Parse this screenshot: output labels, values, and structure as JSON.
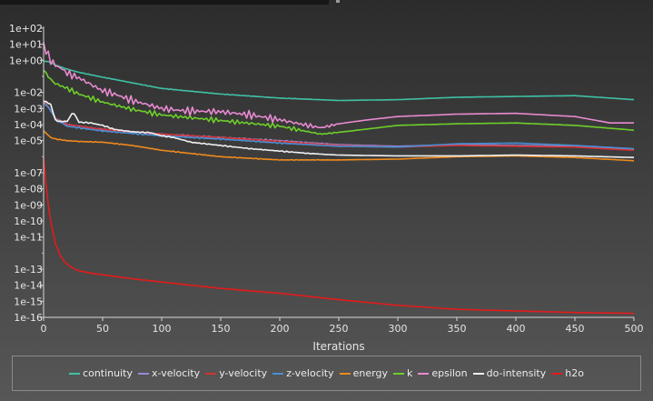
{
  "chart_data": {
    "type": "line",
    "title": "",
    "xlabel": "Iterations",
    "ylabel": "",
    "xlim": [
      0,
      500
    ],
    "x_ticks": [
      0,
      50,
      100,
      150,
      200,
      250,
      300,
      350,
      400,
      450,
      500
    ],
    "y_scale": "log",
    "ylim_exp": [
      -16,
      2
    ],
    "y_tick_labels": [
      "1e+02",
      "1e+01",
      "1e+00",
      "1e-02",
      "1e-03",
      "1e-04",
      "1e-05",
      "1e-07",
      "1e-08",
      "1e-09",
      "1e-10",
      "1e-11",
      "1e-13",
      "1e-14",
      "1e-15",
      "1e-16"
    ],
    "y_tick_exps": [
      2,
      1,
      0,
      -2,
      -3,
      -4,
      -5,
      -7,
      -8,
      -9,
      -10,
      -11,
      -13,
      -14,
      -15,
      -16
    ],
    "grid": false,
    "legend_position": "bottom",
    "series": [
      {
        "name": "continuity",
        "color": "#3fc1a6",
        "x": [
          0,
          5,
          10,
          20,
          30,
          50,
          75,
          100,
          150,
          200,
          250,
          300,
          350,
          400,
          450,
          500
        ],
        "log10y": [
          -0.05,
          -0.1,
          -0.3,
          -0.55,
          -0.75,
          -1.05,
          -1.4,
          -1.75,
          -2.1,
          -2.35,
          -2.5,
          -2.45,
          -2.3,
          -2.25,
          -2.2,
          -2.45
        ]
      },
      {
        "name": "x-velocity",
        "color": "#9a8ad8",
        "x": [
          0,
          5,
          10,
          20,
          30,
          50,
          75,
          100,
          150,
          200,
          250,
          300,
          350,
          400,
          450,
          500
        ],
        "log10y": [
          -2.6,
          -3.0,
          -3.6,
          -4.0,
          -4.1,
          -4.3,
          -4.45,
          -4.6,
          -4.8,
          -5.0,
          -5.25,
          -5.35,
          -5.25,
          -5.3,
          -5.35,
          -5.55
        ]
      },
      {
        "name": "y-velocity",
        "color": "#d63030",
        "x": [
          0,
          5,
          10,
          20,
          30,
          50,
          75,
          100,
          150,
          200,
          250,
          300,
          350,
          400,
          450,
          500
        ],
        "log10y": [
          -2.5,
          -3.0,
          -3.6,
          -4.0,
          -4.1,
          -4.3,
          -4.45,
          -4.6,
          -4.8,
          -5.05,
          -5.3,
          -5.4,
          -5.3,
          -5.35,
          -5.4,
          -5.6
        ]
      },
      {
        "name": "z-velocity",
        "color": "#4a8fd4",
        "x": [
          0,
          5,
          10,
          20,
          30,
          50,
          75,
          100,
          150,
          200,
          250,
          300,
          350,
          400,
          450,
          500
        ],
        "log10y": [
          -2.6,
          -3.0,
          -3.65,
          -4.1,
          -4.2,
          -4.4,
          -4.55,
          -4.7,
          -4.9,
          -5.15,
          -5.35,
          -5.4,
          -5.2,
          -5.15,
          -5.3,
          -5.5
        ]
      },
      {
        "name": "energy",
        "color": "#ee8a1e",
        "x": [
          0,
          3,
          6,
          10,
          20,
          30,
          50,
          75,
          100,
          150,
          200,
          250,
          300,
          350,
          400,
          450,
          500
        ],
        "log10y": [
          -4.4,
          -4.6,
          -4.8,
          -4.9,
          -5.0,
          -5.05,
          -5.1,
          -5.3,
          -5.6,
          -6.0,
          -6.2,
          -6.2,
          -6.15,
          -6.0,
          -5.95,
          -6.05,
          -6.25
        ]
      },
      {
        "name": "k",
        "color": "#6ecf2a",
        "x": [
          0,
          3,
          6,
          10,
          20,
          30,
          50,
          75,
          100,
          150,
          200,
          235,
          260,
          300,
          350,
          400,
          450,
          500
        ],
        "log10y": [
          -0.6,
          -0.9,
          -1.2,
          -1.45,
          -1.75,
          -2.1,
          -2.6,
          -3.05,
          -3.4,
          -3.75,
          -4.1,
          -4.6,
          -4.4,
          -4.05,
          -3.95,
          -3.9,
          -4.05,
          -4.35
        ]
      },
      {
        "name": "epsilon",
        "color": "#e88ad0",
        "x": [
          0,
          2,
          4,
          6,
          10,
          15,
          20,
          30,
          40,
          50,
          60,
          75,
          90,
          100,
          120,
          150,
          175,
          200,
          220,
          235,
          250,
          275,
          300,
          350,
          400,
          450,
          480,
          500
        ],
        "log10y": [
          1.0,
          0.6,
          0.3,
          0.0,
          -0.3,
          -0.5,
          -0.8,
          -1.1,
          -1.5,
          -1.9,
          -2.1,
          -2.5,
          -2.8,
          -3.0,
          -3.15,
          -3.2,
          -3.4,
          -3.7,
          -4.0,
          -4.2,
          -3.95,
          -3.7,
          -3.5,
          -3.35,
          -3.3,
          -3.5,
          -3.9,
          -3.9
        ]
      },
      {
        "name": "do-intensity",
        "color": "#f0f0f0",
        "x": [
          0,
          3,
          6,
          10,
          12,
          20,
          25,
          30,
          40,
          50,
          60,
          75,
          90,
          100,
          110,
          125,
          150,
          175,
          200,
          225,
          250,
          300,
          350,
          400,
          450,
          500
        ],
        "log10y": [
          -2.55,
          -2.6,
          -2.75,
          -3.7,
          -3.8,
          -3.8,
          -3.2,
          -3.85,
          -3.9,
          -4.05,
          -4.3,
          -4.45,
          -4.5,
          -4.7,
          -4.8,
          -5.1,
          -5.3,
          -5.5,
          -5.65,
          -5.8,
          -5.9,
          -5.95,
          -5.95,
          -5.9,
          -5.95,
          -6.05
        ]
      },
      {
        "name": "h2o",
        "color": "#e51a1a",
        "x": [
          0,
          3,
          6,
          10,
          15,
          20,
          25,
          30,
          40,
          50,
          75,
          100,
          150,
          200,
          250,
          300,
          350,
          400,
          450,
          500
        ],
        "log10y": [
          -6.0,
          -8.5,
          -10.0,
          -11.4,
          -12.3,
          -12.7,
          -12.95,
          -13.1,
          -13.25,
          -13.35,
          -13.6,
          -13.8,
          -14.2,
          -14.5,
          -14.9,
          -15.25,
          -15.5,
          -15.6,
          -15.7,
          -15.75
        ]
      }
    ]
  }
}
